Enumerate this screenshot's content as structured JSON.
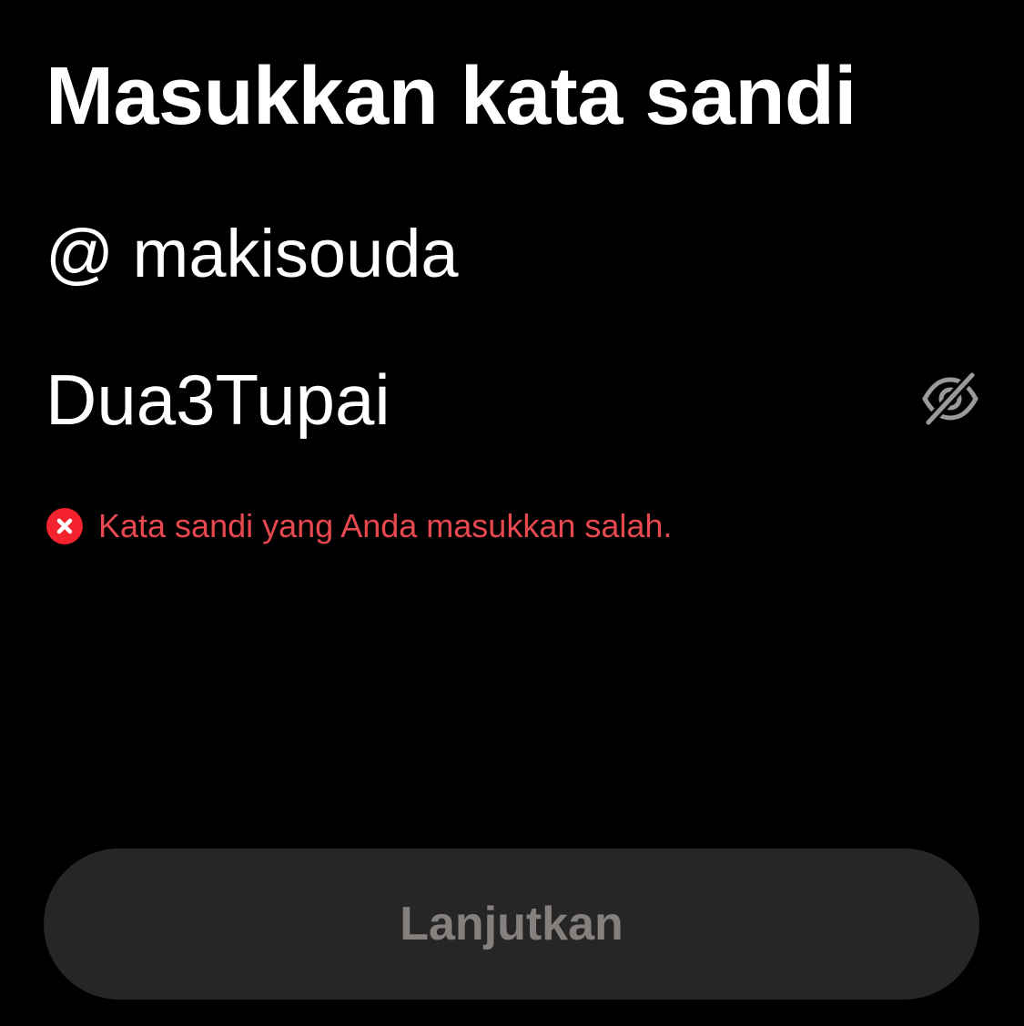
{
  "colors": {
    "background": "#000000",
    "primary_text": "#ffffff",
    "error": "#f4212e",
    "error_text": "#e8484f",
    "icon_muted": "#9a9a9a",
    "button_bg": "#262626",
    "button_text": "#85807d"
  },
  "header": {
    "title": "Masukkan kata sandi"
  },
  "account": {
    "username": "@ makisouda"
  },
  "password": {
    "value": "Dua3Tupai",
    "toggle_icon": "eye-off-icon"
  },
  "error": {
    "icon": "error-x-icon",
    "message": "Kata sandi yang Anda masukkan salah."
  },
  "footer": {
    "next_label": "Lanjutkan"
  }
}
